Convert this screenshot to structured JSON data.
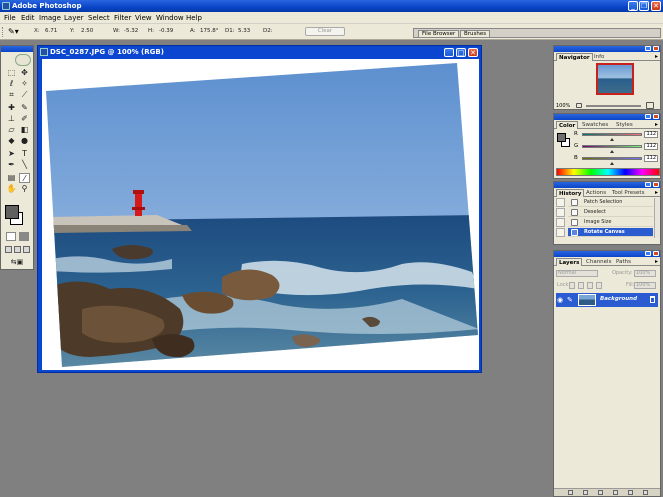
{
  "app": {
    "title": "Adobe Photoshop"
  },
  "menu": [
    "File",
    "Edit",
    "Image",
    "Layer",
    "Select",
    "Filter",
    "View",
    "Window",
    "Help"
  ],
  "options": {
    "fields": [
      {
        "label": "X:",
        "value": "6.71"
      },
      {
        "label": "Y:",
        "value": "2.50"
      },
      {
        "label": "W:",
        "value": "-5.32"
      },
      {
        "label": "H:",
        "value": "-0.39"
      },
      {
        "label": "A:",
        "value": "175.8°"
      },
      {
        "label": "D1:",
        "value": "5.33"
      },
      {
        "label": "D2:",
        "value": ""
      }
    ],
    "clear_label": "Clear"
  },
  "palette_well": {
    "tabs": [
      "File Browser",
      "Brushes"
    ]
  },
  "document": {
    "title": "DSC_0287.JPG @ 100% (RGB)"
  },
  "navigator": {
    "tabs": [
      "Navigator",
      "Info"
    ],
    "zoom": "100%"
  },
  "color": {
    "tabs": [
      "Color",
      "Swatches",
      "Styles"
    ],
    "channels": [
      {
        "label": "R",
        "value": "112"
      },
      {
        "label": "G",
        "value": "112"
      },
      {
        "label": "B",
        "value": "112"
      }
    ],
    "foreground": "#707070"
  },
  "history": {
    "tabs": [
      "History",
      "Actions",
      "Tool Presets"
    ],
    "items": [
      {
        "label": "Patch Selection",
        "active": false
      },
      {
        "label": "Deselect",
        "active": false
      },
      {
        "label": "Image Size",
        "active": false
      },
      {
        "label": "Rotate Canvas",
        "active": true
      }
    ]
  },
  "layers": {
    "tabs": [
      "Layers",
      "Channels",
      "Paths"
    ],
    "blend_mode": "Normal",
    "opacity_label": "Opacity:",
    "opacity": "100%",
    "lock_label": "Lock:",
    "fill_label": "Fill:",
    "fill": "100%",
    "items": [
      {
        "name": "Background",
        "visible": true,
        "locked": true
      }
    ]
  }
}
